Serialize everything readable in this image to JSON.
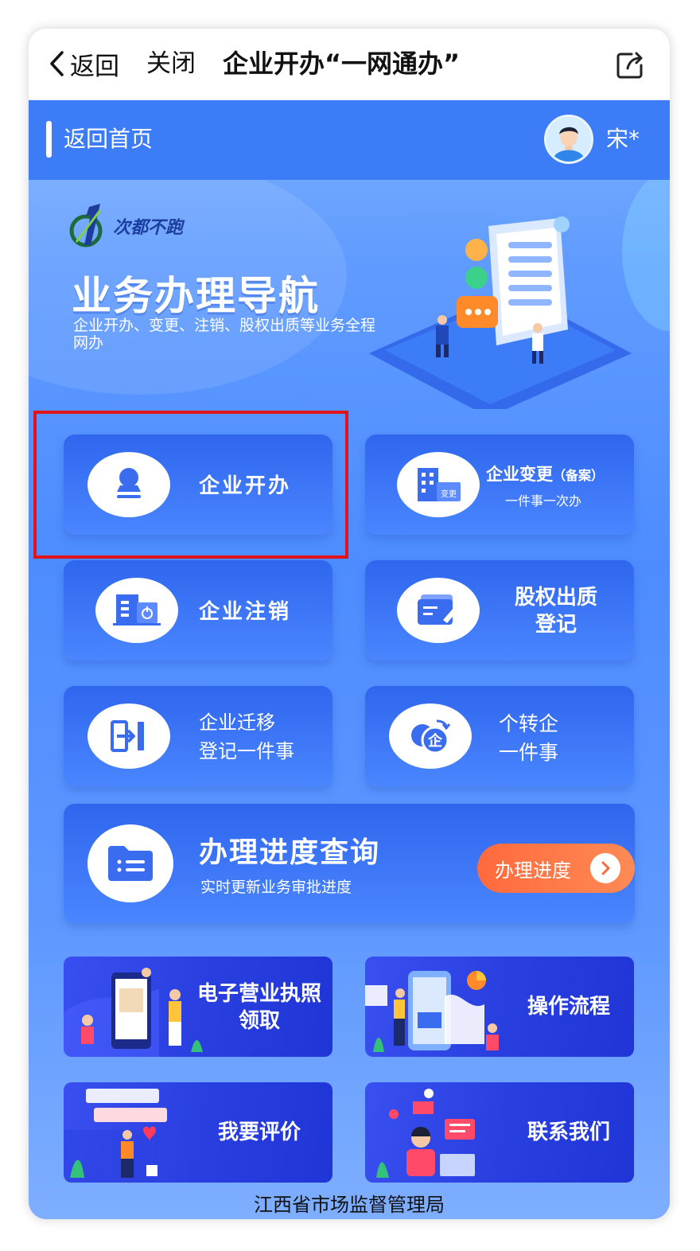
{
  "nav": {
    "back_label": "返回",
    "close_label": "关闭",
    "title": "企业开办“一网通办”"
  },
  "header": {
    "home_label": "返回首页",
    "user_name": "宋*"
  },
  "hero": {
    "slogan": "次都不跑",
    "title": "业务办理导航",
    "subtitle": "企业开办、变更、注销、股权出质等业务全程网办"
  },
  "services": {
    "enterprise_open": "企业开办",
    "enterprise_change": "企业变更",
    "enterprise_change_note": "（备案）",
    "enterprise_change_sub": "一件事一次办",
    "change_badge": "变更",
    "enterprise_cancel": "企业注销",
    "equity_pledge_line1": "股权出质",
    "equity_pledge_line2": "登记",
    "migrate_line1": "企业迁移",
    "migrate_line2": "登记一件事",
    "convert_line1": "个转企",
    "convert_line2": "一件事",
    "convert_badge": "企"
  },
  "progress": {
    "title": "办理进度查询",
    "subtitle": "实时更新业务审批进度",
    "button_label": "办理进度"
  },
  "banners": {
    "license_line1": "电子营业执照",
    "license_line2": "领取",
    "process": "操作流程",
    "rate": "我要评价",
    "contact": "联系我们"
  },
  "footer": "江西省市场监督管理局",
  "colors": {
    "accent": "#3c7cf7",
    "card": "#2f66ee",
    "button": "#ff6a3d",
    "highlight": "#e3131b"
  }
}
